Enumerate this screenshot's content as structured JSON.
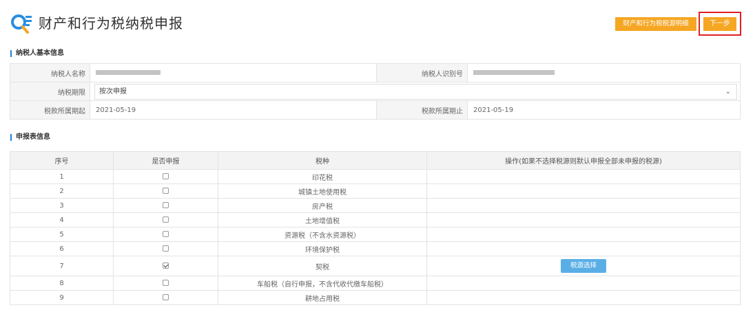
{
  "header": {
    "title": "财产和行为税纳税申报",
    "detail_button": "财产和行为税税源明细",
    "next_button": "下一步",
    "accent": "#f5a623",
    "icon": "search-list-icon"
  },
  "basic_info": {
    "section_title": "纳税人基本信息",
    "taxpayer_name_label": "纳税人名称",
    "taxpayer_id_label": "纳税人识别号",
    "period_label": "纳税期限",
    "period_value": "按次申报",
    "start_label": "税款所属期起",
    "start_value": "2021-05-19",
    "end_label": "税款所属期止",
    "end_value": "2021-05-19"
  },
  "declaration": {
    "section_title": "申报表信息",
    "columns": [
      "序号",
      "是否申报",
      "税种",
      "操作(如果不选择税源则默认申报全部未申报的税源)"
    ],
    "action_button": "税源选择",
    "rows": [
      {
        "no": "1",
        "checked": false,
        "tax": "印花税"
      },
      {
        "no": "2",
        "checked": false,
        "tax": "城镇土地使用税"
      },
      {
        "no": "3",
        "checked": false,
        "tax": "房产税"
      },
      {
        "no": "4",
        "checked": false,
        "tax": "土地增值税"
      },
      {
        "no": "5",
        "checked": false,
        "tax": "资源税（不含水资源税）"
      },
      {
        "no": "6",
        "checked": false,
        "tax": "环境保护税"
      },
      {
        "no": "7",
        "checked": true,
        "tax": "契税"
      },
      {
        "no": "8",
        "checked": false,
        "tax": "车船税（自行申报，不含代收代缴车船税）"
      },
      {
        "no": "9",
        "checked": false,
        "tax": "耕地占用税"
      }
    ]
  }
}
